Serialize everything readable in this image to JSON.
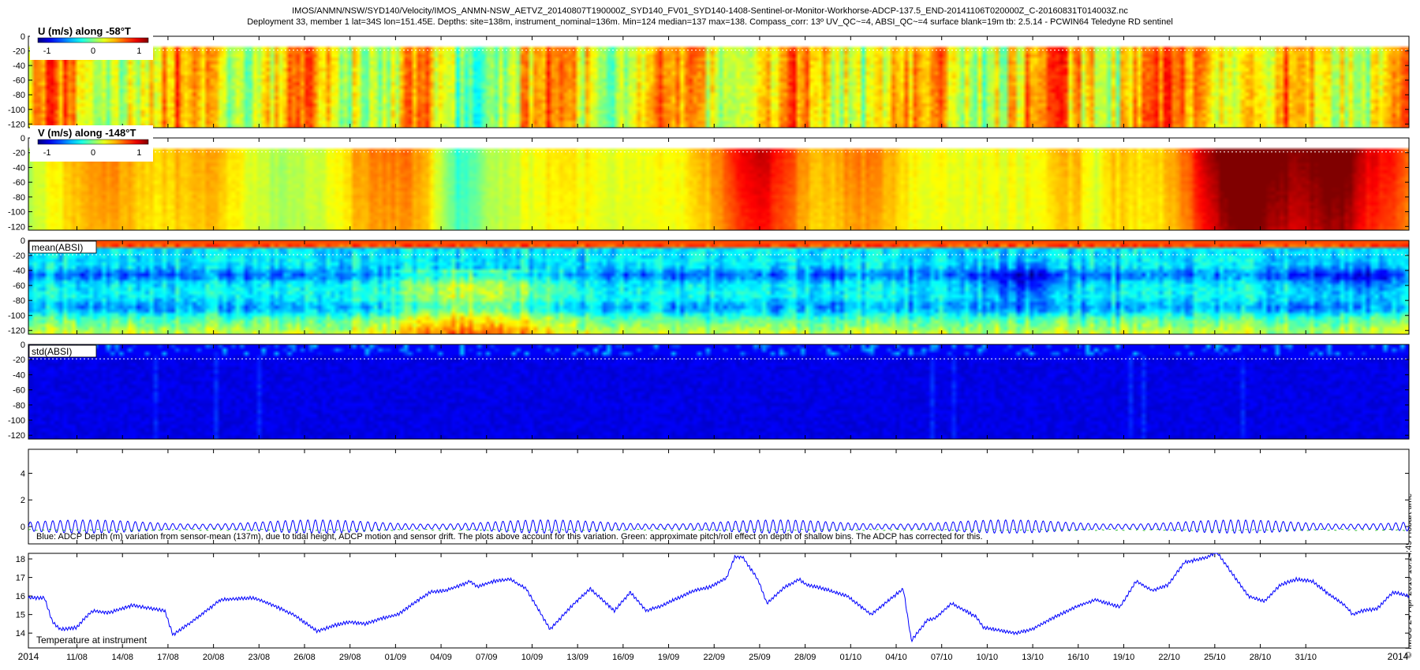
{
  "header": {
    "line1": "IMOS/ANMN/NSW/SYD140/Velocity/IMOS_ANMN-NSW_AETVZ_20140807T190000Z_SYD140_FV01_SYD140-1408-Sentinel-or-Monitor-Workhorse-ADCP-137.5_END-20141106T020000Z_C-20160831T014003Z.nc",
    "line2": "Deployment 33, member 1 lat=34S lon=151.45E. Depths: site=138m, instrument_nominal=136m. Min=124 median=137 max=138. Compass_corr: 13º UV_QC~=4, ABSI_QC~=4 surface blank=19m tb: 2.5.14 - PCWIN64 Teledyne RD sentinel"
  },
  "side_note": "© IMOS 24-Apr-2019 13:14:49 Hobart time",
  "colors": {
    "axis": "#000000",
    "depth_line": "#0000ff",
    "pitch_line": "#00aa00",
    "temp_line": "#0000ff",
    "blank_line": "#ffffff"
  },
  "chart_data": [
    {
      "id": "u",
      "type": "heatmap",
      "title": "U (m/s) along -58°T",
      "colorbar_ticks": [
        "-1",
        "0",
        "1"
      ],
      "clim": [
        -1.2,
        1.2
      ],
      "yticks": [
        "0",
        "-20",
        "-40",
        "-60",
        "-80",
        "-100",
        "-120"
      ],
      "ylim": [
        -125,
        0
      ],
      "surface_blank_depth": -19,
      "pattern": "u"
    },
    {
      "id": "v",
      "type": "heatmap",
      "title": "V (m/s) along -148°T",
      "colorbar_ticks": [
        "-1",
        "0",
        "1"
      ],
      "clim": [
        -1.2,
        1.2
      ],
      "yticks": [
        "0",
        "-20",
        "-40",
        "-60",
        "-80",
        "-100",
        "-120"
      ],
      "ylim": [
        -125,
        0
      ],
      "surface_blank_depth": -19,
      "pattern": "v"
    },
    {
      "id": "mean",
      "type": "heatmap",
      "title": "mean(ABSI)",
      "yticks": [
        "0",
        "-20",
        "-40",
        "-60",
        "-80",
        "-100",
        "-120"
      ],
      "ylim": [
        -125,
        0
      ],
      "surface_blank_depth": -19,
      "pattern": "mean"
    },
    {
      "id": "std",
      "type": "heatmap",
      "title": "std(ABSI)",
      "yticks": [
        "0",
        "-20",
        "-40",
        "-60",
        "-80",
        "-100",
        "-120"
      ],
      "ylim": [
        -125,
        0
      ],
      "surface_blank_depth": -19,
      "pattern": "std"
    },
    {
      "id": "depth",
      "type": "line",
      "caption": "Blue: ADCP Depth (m) variation from sensor-mean (137m), due to tidal height, ADCP motion and sensor drift. The plots above account for this variation. Green: approximate pitch/roll effect on depth of shallow bins. The ADCP has corrected for this.",
      "yticks": [
        "0",
        "2",
        "4"
      ],
      "ylim": [
        -1.3,
        5.8
      ],
      "series": [
        {
          "role": "depth variation",
          "color": "#0000ff",
          "amplitude": 0.45,
          "cycles": 184
        },
        {
          "role": "pitch/roll effect",
          "color": "#00aa00",
          "amplitude": 0.05
        }
      ]
    },
    {
      "id": "temp",
      "type": "line",
      "caption": "Temperature at instrument",
      "yticks": [
        "14",
        "15",
        "16",
        "17",
        "18"
      ],
      "ylim": [
        13.2,
        18.3
      ],
      "series_color": "#0000ff",
      "x": [
        0,
        2,
        3,
        4,
        6,
        7,
        8,
        10,
        13,
        17,
        18,
        20,
        24,
        28,
        30,
        33,
        36,
        38,
        40,
        42,
        44,
        46,
        50,
        52,
        54,
        55,
        56,
        58,
        60,
        62,
        65,
        68,
        70,
        73,
        75,
        77,
        79,
        81,
        83,
        85,
        87,
        88,
        89,
        91,
        92,
        94,
        96,
        97,
        99,
        102,
        105,
        109,
        110,
        112,
        113,
        115,
        118,
        119,
        123,
        125,
        128,
        131,
        133,
        136,
        138,
        140,
        142,
        144,
        147,
        148,
        150,
        152,
        154,
        156,
        158,
        160,
        162,
        164,
        165,
        166,
        168,
        170,
        172
      ],
      "y": [
        15.9,
        15.9,
        14.6,
        14.2,
        14.3,
        14.8,
        15.2,
        15.1,
        15.5,
        15.2,
        13.9,
        14.5,
        15.8,
        15.9,
        15.6,
        15.0,
        14.1,
        14.4,
        14.6,
        14.5,
        14.8,
        15.0,
        16.2,
        16.3,
        16.6,
        16.8,
        16.5,
        16.8,
        16.9,
        16.4,
        14.2,
        15.6,
        16.4,
        15.2,
        16.2,
        15.2,
        15.5,
        15.9,
        16.3,
        16.5,
        17.0,
        18.1,
        18.1,
        16.8,
        15.6,
        16.4,
        16.9,
        16.6,
        16.4,
        16.0,
        15.0,
        16.4,
        13.6,
        14.7,
        14.8,
        15.6,
        14.9,
        14.3,
        14.0,
        14.2,
        14.9,
        15.5,
        15.8,
        15.4,
        16.8,
        16.3,
        16.6,
        17.8,
        18.1,
        18.4,
        17.2,
        16.0,
        15.7,
        16.6,
        16.9,
        16.8,
        16.1,
        15.5,
        15.0,
        15.2,
        15.3,
        16.2,
        16.0,
        17.3
      ]
    }
  ],
  "time_axis": {
    "days": 91,
    "year_start_label": "2014",
    "year_end_label": "2014",
    "ticks": [
      {
        "day": 3.2,
        "label": "11/08"
      },
      {
        "day": 6.2,
        "label": "14/08"
      },
      {
        "day": 9.2,
        "label": "17/08"
      },
      {
        "day": 12.2,
        "label": "20/08"
      },
      {
        "day": 15.2,
        "label": "23/08"
      },
      {
        "day": 18.2,
        "label": "26/08"
      },
      {
        "day": 21.2,
        "label": "29/08"
      },
      {
        "day": 24.2,
        "label": "01/09"
      },
      {
        "day": 27.2,
        "label": "04/09"
      },
      {
        "day": 30.2,
        "label": "07/09"
      },
      {
        "day": 33.2,
        "label": "10/09"
      },
      {
        "day": 36.2,
        "label": "13/09"
      },
      {
        "day": 39.2,
        "label": "16/09"
      },
      {
        "day": 42.2,
        "label": "19/09"
      },
      {
        "day": 45.2,
        "label": "22/09"
      },
      {
        "day": 48.2,
        "label": "25/09"
      },
      {
        "day": 51.2,
        "label": "28/09"
      },
      {
        "day": 54.2,
        "label": "01/10"
      },
      {
        "day": 57.2,
        "label": "04/10"
      },
      {
        "day": 60.2,
        "label": "07/10"
      },
      {
        "day": 63.2,
        "label": "10/10"
      },
      {
        "day": 66.2,
        "label": "13/10"
      },
      {
        "day": 69.2,
        "label": "16/10"
      },
      {
        "day": 72.2,
        "label": "19/10"
      },
      {
        "day": 75.2,
        "label": "22/10"
      },
      {
        "day": 78.2,
        "label": "25/10"
      },
      {
        "day": 81.2,
        "label": "28/10"
      },
      {
        "day": 84.2,
        "label": "31/10"
      }
    ]
  }
}
